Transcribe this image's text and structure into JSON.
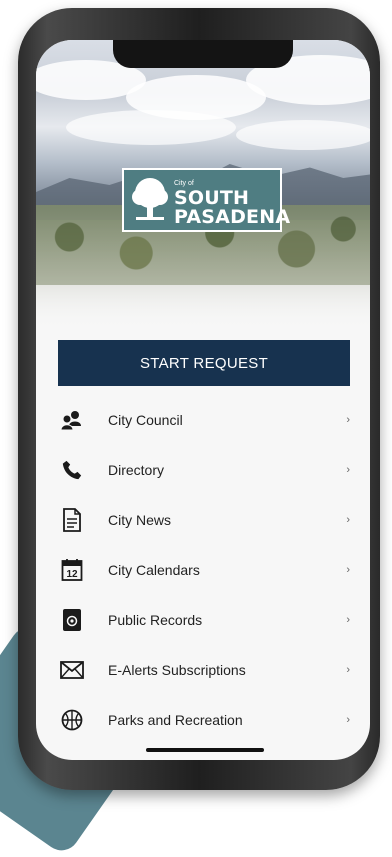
{
  "logo": {
    "small_text": "City of",
    "line1": "SOUTH",
    "line2": "PASADENA"
  },
  "start_request_label": "START REQUEST",
  "menu": [
    {
      "label": "City Council",
      "icon": "people-group-icon"
    },
    {
      "label": "Directory",
      "icon": "phone-icon"
    },
    {
      "label": "City News",
      "icon": "document-icon"
    },
    {
      "label": "City Calendars",
      "icon": "calendar-icon"
    },
    {
      "label": "Public Records",
      "icon": "records-icon"
    },
    {
      "label": "E-Alerts Subscriptions",
      "icon": "envelope-icon"
    },
    {
      "label": "Parks and Recreation",
      "icon": "basketball-icon"
    }
  ],
  "chevron": "›",
  "calendar_day": "12",
  "colors": {
    "primary": "#17324f",
    "logo_bg": "#4f7d82",
    "accent_shape": "#5b8590"
  }
}
